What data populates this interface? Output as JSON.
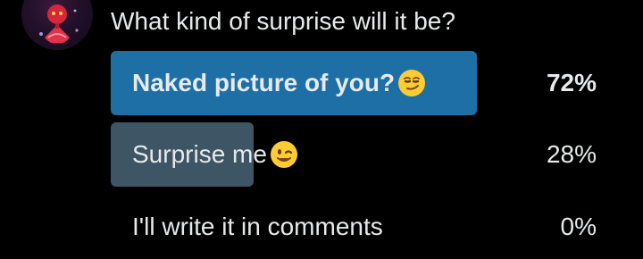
{
  "poll": {
    "question": "What kind of surprise will it be?",
    "options": [
      {
        "label": "Naked picture of you?",
        "emoji": "smirking-face",
        "percent_label": "72%",
        "percent": 72,
        "fill_color": "#1d6fa5",
        "leading": true
      },
      {
        "label": "Surprise me",
        "emoji": "winking-face",
        "percent_label": "28%",
        "percent": 28,
        "fill_color": "#3e5566",
        "leading": false
      },
      {
        "label": "I'll write it in comments",
        "emoji": "",
        "percent_label": "0%",
        "percent": 0,
        "fill_color": "#3e5566",
        "leading": false
      }
    ]
  },
  "colors": {
    "background": "#000000",
    "text": "#e7e9ea",
    "leading_bar": "#1d6fa5",
    "other_bar": "#3e5566"
  }
}
